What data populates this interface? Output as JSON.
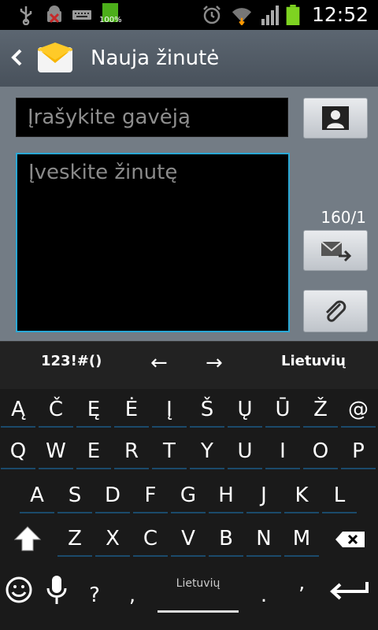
{
  "status_bar": {
    "time": "12:52",
    "icons": [
      "usb-icon",
      "android-debug-icon",
      "keyboard-icon",
      "battery-full-icon",
      "alarm-icon",
      "wifi-icon",
      "signal-icon",
      "battery-icon"
    ],
    "battery_label": "100%"
  },
  "header": {
    "title": "Nauja žinutė",
    "back_icon": "chevron-left-icon",
    "app_icon": "envelope-icon"
  },
  "compose": {
    "recipient_placeholder": "Įrašykite gavėją",
    "message_placeholder": "Įveskite žinutę",
    "char_counter": "160/1",
    "contact_icon": "contact-icon",
    "send_icon": "send-message-icon",
    "attach_icon": "paperclip-icon"
  },
  "keyboard": {
    "mode_label": "123!#()",
    "arrow_left": "←",
    "arrow_right": "→",
    "language": "Lietuvių",
    "space_label": "Lietuvių",
    "row1": [
      "Ą",
      "Č",
      "Ę",
      "Ė",
      "Į",
      "Š",
      "Ų",
      "Ū",
      "Ž",
      "@"
    ],
    "row2": [
      "Q",
      "W",
      "E",
      "R",
      "T",
      "Y",
      "U",
      "I",
      "O",
      "P"
    ],
    "row3": [
      "A",
      "S",
      "D",
      "F",
      "G",
      "H",
      "J",
      "K",
      "L"
    ],
    "row4": [
      "Z",
      "X",
      "C",
      "V",
      "B",
      "N",
      "M"
    ],
    "question": "?",
    "comma": ",",
    "period": ".",
    "apostrophe": "’",
    "accent_color": "#2aa8d6"
  }
}
